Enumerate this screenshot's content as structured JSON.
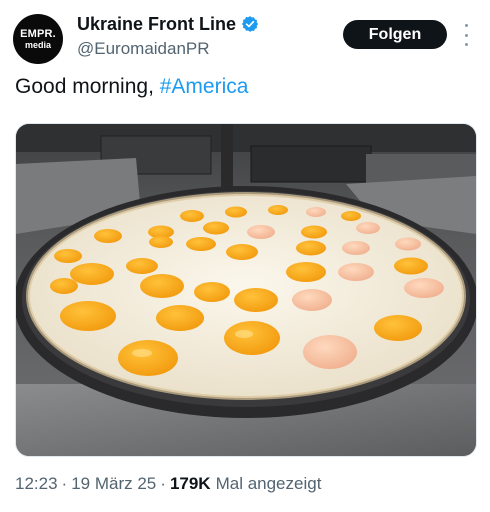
{
  "author": {
    "avatar_line1": "EMPR.",
    "avatar_line2": "media",
    "display_name": "Ukraine Front Line",
    "handle": "@EuromaidanPR",
    "verified_color": "#1d9bf0"
  },
  "actions": {
    "follow_label": "Folgen",
    "more_icon": "more-vertical-icon"
  },
  "tweet": {
    "text_prefix": "Good morning, ",
    "hashtag": "#America"
  },
  "media": {
    "image_content": "fried-eggs-on-large-pan"
  },
  "meta": {
    "time": "12:23",
    "date": "19 März 25",
    "separator": "·",
    "views_count": "179K",
    "views_label": "Mal angezeigt"
  },
  "colors": {
    "accent": "#1d9bf0",
    "text_primary": "#0f1419",
    "text_secondary": "#536471"
  }
}
